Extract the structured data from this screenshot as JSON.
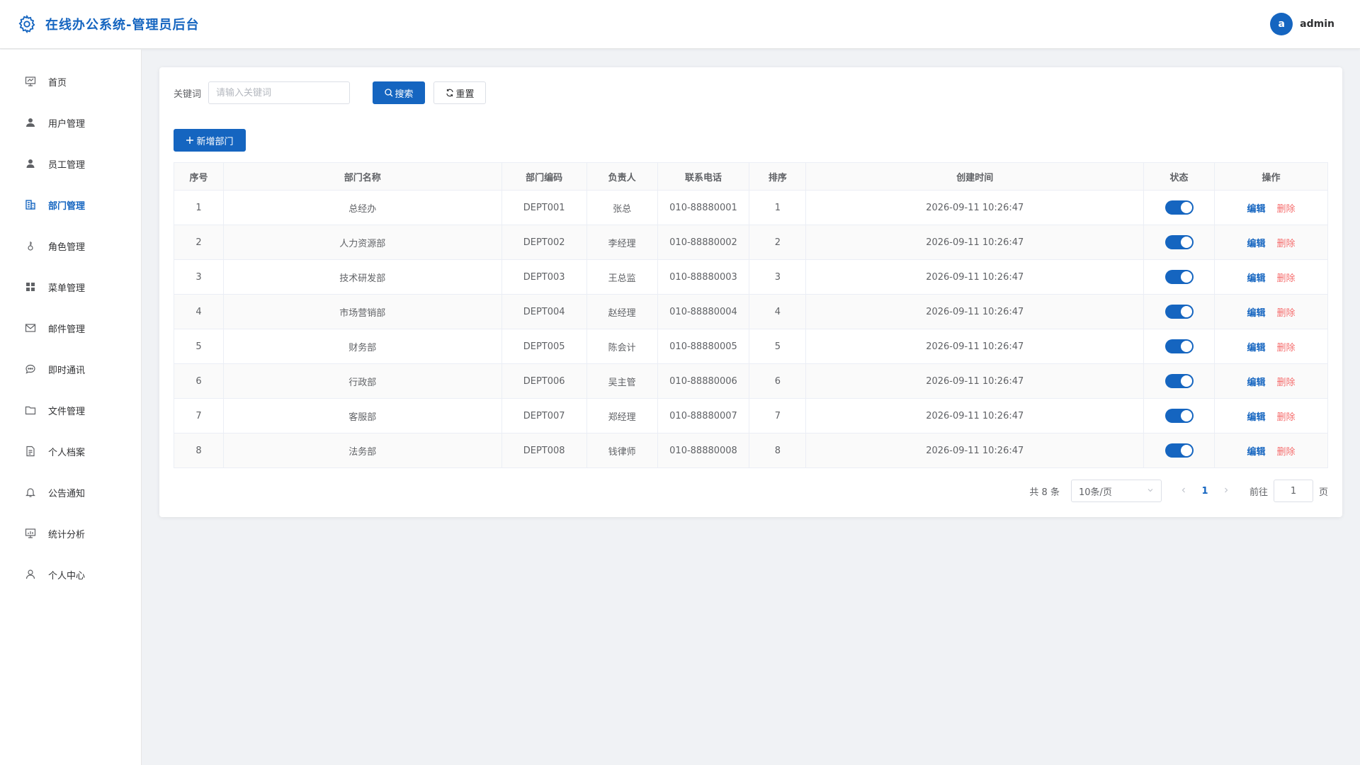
{
  "header": {
    "title": "在线办公系统-管理员后台",
    "avatar_letter": "a",
    "username": "admin"
  },
  "sidebar": {
    "items": [
      {
        "label": "首页",
        "icon": "presentation-icon",
        "active": false
      },
      {
        "label": "用户管理",
        "icon": "user-filled-icon",
        "active": false
      },
      {
        "label": "员工管理",
        "icon": "user-filled-icon",
        "active": false
      },
      {
        "label": "部门管理",
        "icon": "office-building-icon",
        "active": true
      },
      {
        "label": "角色管理",
        "icon": "key-icon",
        "active": false
      },
      {
        "label": "菜单管理",
        "icon": "grid-icon",
        "active": false
      },
      {
        "label": "邮件管理",
        "icon": "mail-icon",
        "active": false
      },
      {
        "label": "即时通讯",
        "icon": "chat-icon",
        "active": false
      },
      {
        "label": "文件管理",
        "icon": "folder-icon",
        "active": false
      },
      {
        "label": "个人档案",
        "icon": "document-icon",
        "active": false
      },
      {
        "label": "公告通知",
        "icon": "bell-icon",
        "active": false
      },
      {
        "label": "统计分析",
        "icon": "chart-board-icon",
        "active": false
      },
      {
        "label": "个人中心",
        "icon": "user-outline-icon",
        "active": false
      }
    ]
  },
  "search": {
    "keyword_label": "关键词",
    "keyword_placeholder": "请输入关键词",
    "keyword_value": "",
    "search_label": "搜索",
    "reset_label": "重置"
  },
  "toolbar": {
    "add_label": "新增部门"
  },
  "table": {
    "headers": [
      "序号",
      "部门名称",
      "部门编码",
      "负责人",
      "联系电话",
      "排序",
      "创建时间",
      "状态",
      "操作"
    ],
    "rows": [
      {
        "no": "1",
        "name": "总经办",
        "code": "DEPT001",
        "manager": "张总",
        "phone": "010-88880001",
        "sort": "1",
        "created": "2026-09-11 10:26:47",
        "enabled": true
      },
      {
        "no": "2",
        "name": "人力资源部",
        "code": "DEPT002",
        "manager": "李经理",
        "phone": "010-88880002",
        "sort": "2",
        "created": "2026-09-11 10:26:47",
        "enabled": true
      },
      {
        "no": "3",
        "name": "技术研发部",
        "code": "DEPT003",
        "manager": "王总监",
        "phone": "010-88880003",
        "sort": "3",
        "created": "2026-09-11 10:26:47",
        "enabled": true
      },
      {
        "no": "4",
        "name": "市场营销部",
        "code": "DEPT004",
        "manager": "赵经理",
        "phone": "010-88880004",
        "sort": "4",
        "created": "2026-09-11 10:26:47",
        "enabled": true
      },
      {
        "no": "5",
        "name": "财务部",
        "code": "DEPT005",
        "manager": "陈会计",
        "phone": "010-88880005",
        "sort": "5",
        "created": "2026-09-11 10:26:47",
        "enabled": true
      },
      {
        "no": "6",
        "name": "行政部",
        "code": "DEPT006",
        "manager": "吴主管",
        "phone": "010-88880006",
        "sort": "6",
        "created": "2026-09-11 10:26:47",
        "enabled": true
      },
      {
        "no": "7",
        "name": "客服部",
        "code": "DEPT007",
        "manager": "郑经理",
        "phone": "010-88880007",
        "sort": "7",
        "created": "2026-09-11 10:26:47",
        "enabled": true
      },
      {
        "no": "8",
        "name": "法务部",
        "code": "DEPT008",
        "manager": "钱律师",
        "phone": "010-88880008",
        "sort": "8",
        "created": "2026-09-11 10:26:47",
        "enabled": true
      }
    ],
    "edit_label": "编辑",
    "delete_label": "删除"
  },
  "pagination": {
    "total_text": "共 8 条",
    "page_size": "10条/页",
    "current_page": "1",
    "goto_label": "前往",
    "goto_value": "1",
    "page_suffix": "页"
  },
  "colors": {
    "primary": "#1565c0",
    "danger": "#f56c6c"
  }
}
